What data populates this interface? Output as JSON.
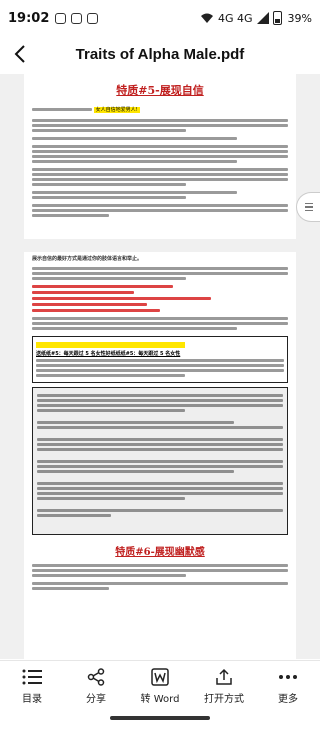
{
  "status": {
    "time": "19:02",
    "signal": "4G 4G",
    "battery": "39%"
  },
  "header": {
    "back": "‹",
    "title": "Traits of Alpha Male.pdf"
  },
  "document": {
    "page1_heading": "特质#5-展现自信",
    "page1_highlight": "女人自信地爱男人!",
    "page2_bold_intro": "展示自信的最好方式是通过你的肢体语言和举止。",
    "boxed_line": "送纸纸#5：每天跟过 5 名女性好纸纸纸#5：每天跟过 5 名女性",
    "page2_heading": "特质#6-展现幽默感"
  },
  "toolbar": {
    "items": [
      {
        "label": "目录",
        "icon": "list-icon"
      },
      {
        "label": "分享",
        "icon": "share-icon"
      },
      {
        "label": "转 Word",
        "icon": "word-convert-icon"
      },
      {
        "label": "打开方式",
        "icon": "open-with-icon"
      },
      {
        "label": "更多",
        "icon": "more-icon"
      }
    ]
  }
}
